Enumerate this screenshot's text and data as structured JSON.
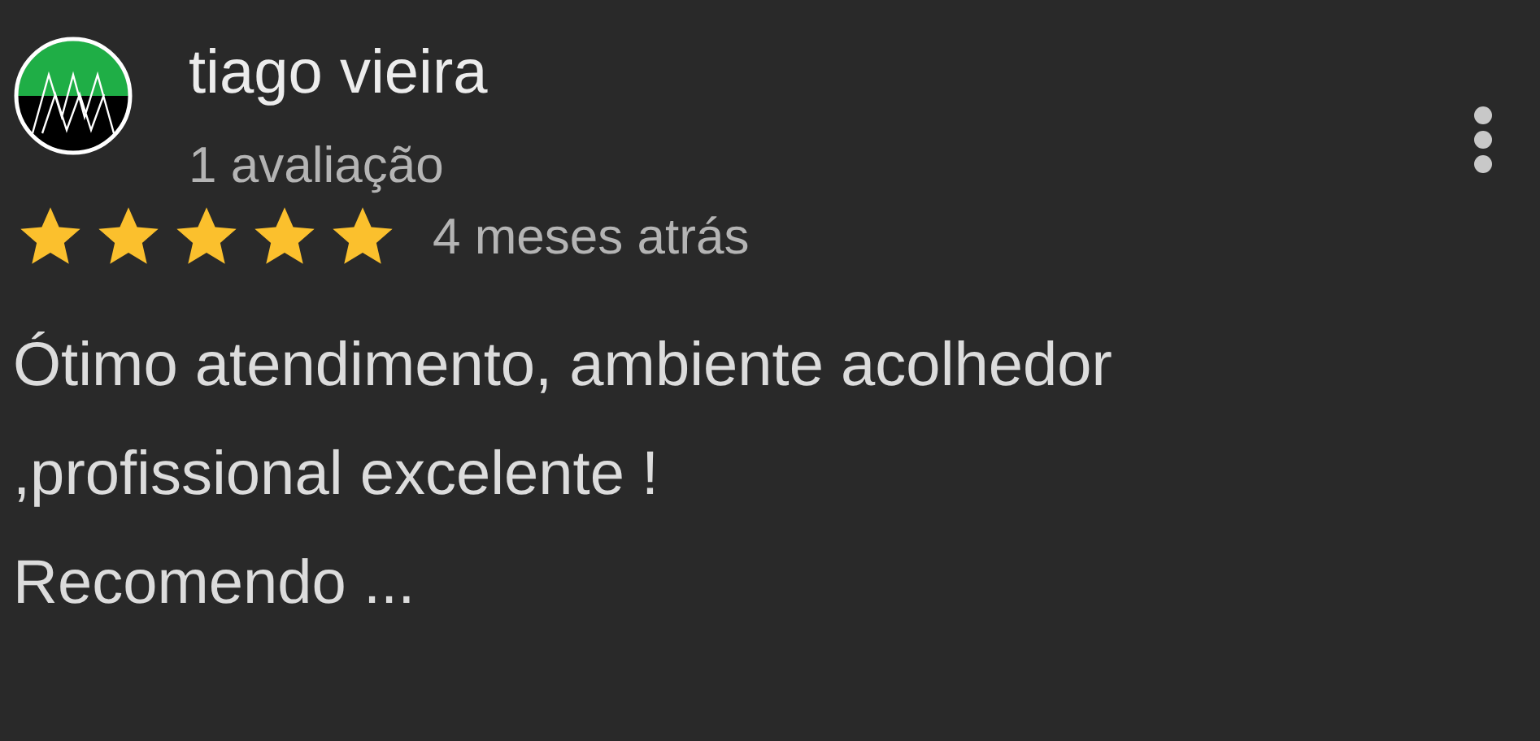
{
  "review": {
    "author": "tiago vieira",
    "author_meta": "1 avaliação",
    "stars": 5,
    "time": "4 meses atrás",
    "text_lines": [
      "Ótimo atendimento, ambiente acolhedor",
      ",profissional excelente !",
      "Recomendo ..."
    ]
  }
}
